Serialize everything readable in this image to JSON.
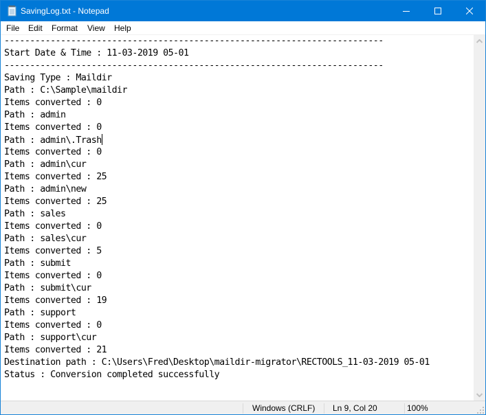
{
  "window": {
    "title": "SavingLog.txt - Notepad",
    "accent_color": "#0078d7"
  },
  "caption_buttons": {
    "minimize_icon": "minimize-icon",
    "maximize_icon": "maximize-icon",
    "close_icon": "close-icon"
  },
  "menu": {
    "items": [
      {
        "label": "File"
      },
      {
        "label": "Edit"
      },
      {
        "label": "Format"
      },
      {
        "label": "View"
      },
      {
        "label": "Help"
      }
    ]
  },
  "document": {
    "lines": [
      "--------------------------------------------------------------------------",
      "Start Date & Time : 11-03-2019 05-01",
      "--------------------------------------------------------------------------",
      "Saving Type : Maildir",
      "Path : C:\\Sample\\maildir",
      "Items converted : 0",
      "Path : admin",
      "Items converted : 0",
      "Path : admin\\.Trash",
      "Items converted : 0",
      "Path : admin\\cur",
      "Items converted : 25",
      "Path : admin\\new",
      "Items converted : 25",
      "Path : sales",
      "Items converted : 0",
      "Path : sales\\cur",
      "Items converted : 5",
      "Path : submit",
      "Items converted : 0",
      "Path : submit\\cur",
      "Items converted : 19",
      "Path : support",
      "Items converted : 0",
      "Path : support\\cur",
      "Items converted : 21",
      "Destination path : C:\\Users\\Fred\\Desktop\\maildir-migrator\\RECTOOLS_11-03-2019 05-01",
      "Status : Conversion completed successfully"
    ],
    "caret_line_index": 8
  },
  "statusbar": {
    "line_ending": "Windows (CRLF)",
    "position": "Ln 9, Col 20",
    "zoom": "100%"
  }
}
